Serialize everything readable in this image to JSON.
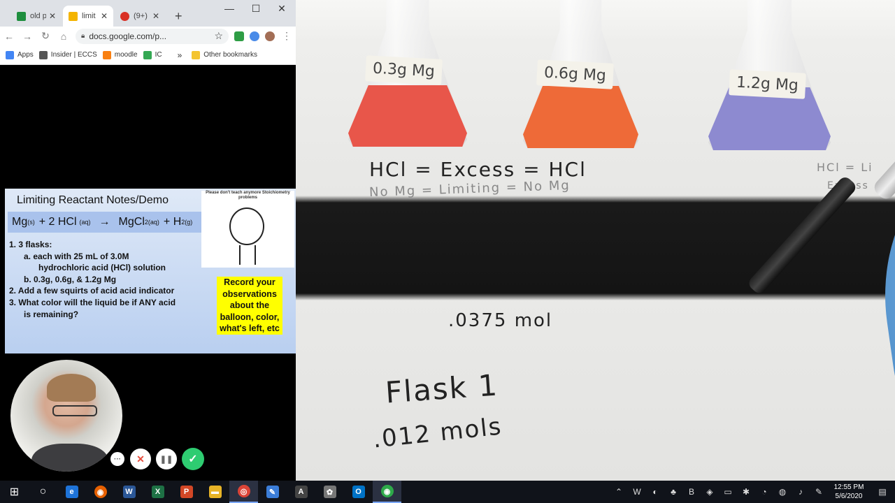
{
  "browser": {
    "tabs": [
      {
        "title": "old p",
        "color": "#1e8e3e",
        "active": false
      },
      {
        "title": "limit",
        "color": "#f4b400",
        "active": true
      },
      {
        "title": "(9+)",
        "color": "#d93025",
        "active": false
      }
    ],
    "new_tab": "+",
    "close_glyph": "✕",
    "window_controls": {
      "minimize": "—",
      "maximize": "☐",
      "close": "✕"
    },
    "url": "docs.google.com/p...",
    "bookmarks": [
      {
        "label": "Apps",
        "color": "#4285f4"
      },
      {
        "label": "Insider | ECCS",
        "color": "#555555"
      },
      {
        "label": "moodle",
        "color": "#f98012"
      },
      {
        "label": "IC",
        "color": "#34a853"
      }
    ],
    "more_bookmarks": "»",
    "other_bookmarks": "Other bookmarks"
  },
  "slide": {
    "title": "Limiting Reactant Notes/Demo",
    "equation": {
      "mg": "Mg",
      "mg_state": "(s)",
      "hcl": "+  2 HCl",
      "hcl_state": "(aq)",
      "arrow": "→",
      "mgcl": "MgCl",
      "mgcl_state": "2(aq)",
      "h": "+ H",
      "h_state": "2(g)"
    },
    "notes": [
      "1.   3 flasks:",
      "a.   each with 25 mL of 3.0M",
      "hydrochloric acid (HCl) solution",
      "b.   0.3g, 0.6g, & 1.2g Mg",
      "2.   Add a few squirts of acid acid indicator",
      "3.   What color will the liquid be if ANY acid",
      "is remaining?"
    ],
    "meme_caption": "Please don't teach anymore Stoichiometry problems",
    "record_note": "Record your observations about the balloon, color, what's left, etc"
  },
  "camera": {
    "flask_labels": [
      "0.3g Mg",
      "0.6g Mg",
      "1.2g Mg"
    ],
    "whiteboard_top": [
      "HCl = Excess = HCl",
      "No Mg = Limiting = No Mg",
      "HCl = Li",
      "Excess"
    ],
    "whiteboard_bottom": [
      ".0375 mol",
      "Flask 1",
      ".012 mols"
    ],
    "colors": {
      "flask1": "#e8564a",
      "flask2": "#ee6a38",
      "flask3": "#8d8ad0",
      "glove": "#5b9bd8"
    }
  },
  "call_controls": {
    "more": "···",
    "end": "✕",
    "pause": "❚❚",
    "done": "✓"
  },
  "taskbar": {
    "start": "⊞",
    "search": "○",
    "apps": [
      {
        "name": "edge",
        "glyph": "e",
        "color": "#1e73d8"
      },
      {
        "name": "firefox",
        "glyph": "◉",
        "color": "#e66000"
      },
      {
        "name": "word",
        "glyph": "W",
        "color": "#2b5797"
      },
      {
        "name": "excel",
        "glyph": "X",
        "color": "#1e7145"
      },
      {
        "name": "powerpoint",
        "glyph": "P",
        "color": "#d24726"
      },
      {
        "name": "file-explorer",
        "glyph": "▬",
        "color": "#e8b427"
      },
      {
        "name": "chrome",
        "glyph": "◎",
        "color": "#db4437"
      },
      {
        "name": "paint",
        "glyph": "✎",
        "color": "#3b7dd8"
      },
      {
        "name": "app-a",
        "glyph": "A",
        "color": "#444444"
      },
      {
        "name": "app-b",
        "glyph": "✿",
        "color": "#777777"
      },
      {
        "name": "outlook",
        "glyph": "O",
        "color": "#0072c6"
      },
      {
        "name": "screencast",
        "glyph": "◉",
        "color": "#2eaa4a"
      }
    ],
    "tray": [
      "⌃",
      "W",
      "◐",
      "♣",
      "B",
      "◈",
      "▭",
      "✱",
      "◔",
      "◍",
      "♪",
      "✎"
    ],
    "time": "12:55 PM",
    "date": "5/6/2020",
    "notifications": "▤"
  }
}
